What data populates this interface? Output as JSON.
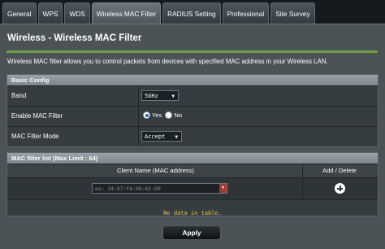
{
  "tabs": [
    {
      "label": "General",
      "active": false
    },
    {
      "label": "WPS",
      "active": false
    },
    {
      "label": "WDS",
      "active": false
    },
    {
      "label": "Wireless MAC Filter",
      "active": true
    },
    {
      "label": "RADIUS Setting",
      "active": false
    },
    {
      "label": "Professional",
      "active": false
    },
    {
      "label": "Site Survey",
      "active": false
    }
  ],
  "page": {
    "title": "Wireless - Wireless MAC Filter",
    "description": "Wireless MAC filter allows you to control packets from devices with specified MAC address in your Wireless LAN."
  },
  "basic_config": {
    "header": "Basic Config",
    "band_label": "Band",
    "band_value": "5GHz",
    "enable_label": "Enable MAC Filter",
    "enable_yes": "Yes",
    "enable_no": "No",
    "enable_selected": "Yes",
    "mode_label": "MAC Filter Mode",
    "mode_value": "Accept"
  },
  "mac_list": {
    "header": "MAC filter list (Max Limit : 64)",
    "col_client": "Client Name (MAC address)",
    "col_action": "Add / Delete",
    "input_placeholder": "ex: 34:97:F6:06:62:D0",
    "empty_text": "No data in table."
  },
  "actions": {
    "apply_label": "Apply"
  },
  "colors": {
    "accent_rule": "#6d9e45",
    "empty_text": "#e8c74a",
    "dropdown_button": "#a33a2e"
  }
}
